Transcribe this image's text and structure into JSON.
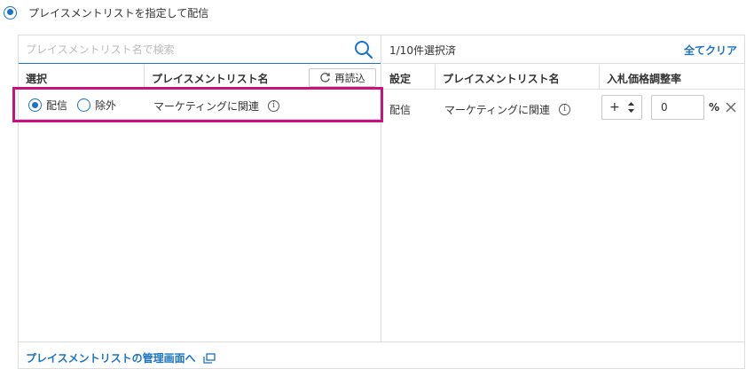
{
  "top_option": {
    "label": "プレイスメントリストを指定して配信",
    "selected": true
  },
  "search": {
    "placeholder": "プレイスメントリスト名で検索"
  },
  "left_table": {
    "col_select": "選択",
    "col_name": "プレイスメントリスト名",
    "reload_label": "再読込",
    "rows": [
      {
        "option_deliver": "配信",
        "option_exclude": "除外",
        "name": "マーケティングに関連",
        "deliver_selected": true
      }
    ]
  },
  "right_panel": {
    "selection_count": "1/10件選択済",
    "clear_all": "全てクリア",
    "col_setting": "設定",
    "col_name": "プレイスメントリスト名",
    "col_bid": "入札価格調整率",
    "rows": [
      {
        "setting": "配信",
        "name": "マーケティングに関連",
        "sign": "+",
        "value": "0",
        "unit": "%"
      }
    ]
  },
  "footer": {
    "link": "プレイスメントリストの管理画面へ"
  },
  "colors": {
    "accent": "#1a73c9",
    "highlight": "#c8127e",
    "border": "#dcdcdc"
  }
}
